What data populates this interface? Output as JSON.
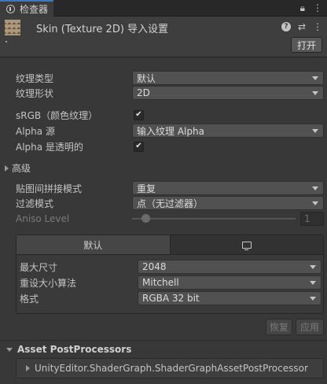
{
  "window": {
    "tab_label": "检查器",
    "lock_icon": "lock-icon",
    "menu_icon": "kebab-menu-icon"
  },
  "header": {
    "title": "Skin (Texture 2D) 导入设置",
    "open_label": "打开",
    "help_glyph": "?",
    "presets_glyph": "⇄",
    "menu_glyph": "⋮"
  },
  "fields": {
    "texture_type": {
      "label": "纹理类型",
      "value": "默认"
    },
    "texture_shape": {
      "label": "纹理形状",
      "value": "2D"
    },
    "srgb": {
      "label": "sRGB（颜色纹理）",
      "checked": true
    },
    "alpha_source": {
      "label": "Alpha 源",
      "value": "输入纹理 Alpha"
    },
    "alpha_transparency": {
      "label": "Alpha 是透明的",
      "checked": true
    },
    "advanced": {
      "label": "高级"
    },
    "wrap_mode": {
      "label": "贴图间拼接模式",
      "value": "重复"
    },
    "filter_mode": {
      "label": "过滤模式",
      "value": "点（无过滤器）"
    },
    "aniso_level": {
      "label": "Aniso Level",
      "value": "1",
      "slider_fraction": 0.0
    }
  },
  "platform": {
    "default_tab": "默认",
    "monitor_icon": "monitor-icon",
    "max_size": {
      "label": "最大尺寸",
      "value": "2048"
    },
    "resize_algorithm": {
      "label": "重设大小算法",
      "value": "Mitchell"
    },
    "format": {
      "label": "格式",
      "value": "RGBA 32 bit"
    }
  },
  "actions": {
    "revert_label": "恢复",
    "apply_label": "应用"
  },
  "postprocessors": {
    "title": "Asset PostProcessors",
    "items": [
      "UnityEditor.ShaderGraph.ShaderGraphAssetPostProcessor"
    ]
  },
  "colors": {
    "background": "#383838",
    "accent": "#3a79bb"
  }
}
